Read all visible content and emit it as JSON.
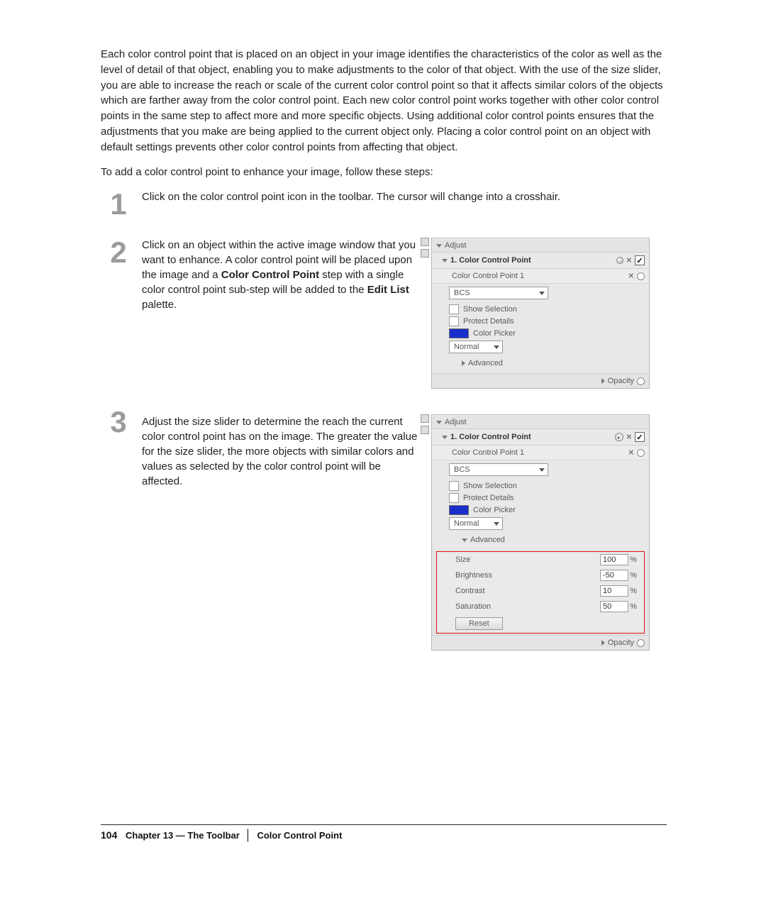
{
  "intro": "Each color control point that is placed on an object in your image identifies the characteristics of the color as well as the level of detail of that object, enabling you to make adjustments to the color of that object. With the use of the size slider, you are able to increase the reach or scale of the current color control point so that it affects similar colors of the objects which are farther away from the color control point. Each new color control point works together with other color control points in the same step to affect more and more specific objects. Using additional color control points ensures that the adjustments that you make are being applied to the current object only. Placing a color control point on an object with default settings prevents other color control points from affecting that object.",
  "lead": "To add a color control point to enhance your image, follow these steps:",
  "steps": {
    "n1": "1",
    "t1": "Click on the color control point icon in the toolbar. The cursor will change into a crosshair.",
    "n2": "2",
    "t2a": "Click on an object within the active image window that you want to enhance. A color control point will be placed upon the image and a ",
    "t2b": "Color Control Point",
    "t2c": " step with a single color control point sub-step will be added to the ",
    "t2d": "Edit List",
    "t2e": " palette.",
    "n3": "3",
    "t3": "Adjust the size slider to determine the reach the current color control point has on the image. The greater the value for the size slider, the more objects with similar colors and values as selected by the color control point will be affected."
  },
  "panel": {
    "adjust": "Adjust",
    "step_title": "1. Color Control Point",
    "substep": "Color Control Point 1",
    "bcs": "BCS",
    "show_sel": "Show Selection",
    "protect": "Protect Details",
    "colorpicker": "Color Picker",
    "normal": "Normal",
    "advanced": "Advanced",
    "opacity": "Opacity",
    "size_l": "Size",
    "bright_l": "Brightness",
    "contrast_l": "Contrast",
    "sat_l": "Saturation",
    "size_v": "100",
    "bright_v": "-50",
    "contrast_v": "10",
    "sat_v": "50",
    "unit": "%",
    "reset": "Reset",
    "check": "✓"
  },
  "footer": {
    "page": "104",
    "chapter": "Chapter 13 — The Toolbar",
    "section": "Color Control Point"
  }
}
